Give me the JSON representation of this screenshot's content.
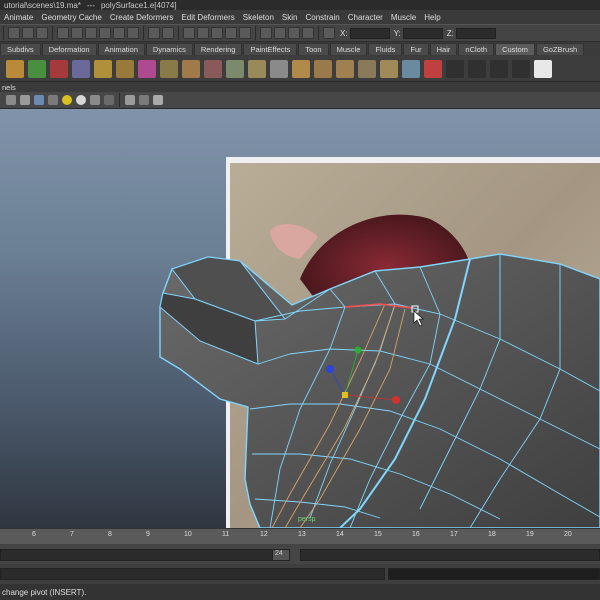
{
  "titlebar": {
    "scene": "utorial\\scenes\\19.ma*",
    "dash": "---",
    "object": "polySurface1.e[4074]"
  },
  "menubar": [
    "Animate",
    "Geometry Cache",
    "Create Deformers",
    "Edit Deformers",
    "Skeleton",
    "Skin",
    "Constrain",
    "Character",
    "Muscle",
    "Help"
  ],
  "statusline": {
    "x_label": "X:",
    "y_label": "Y:",
    "z_label": "Z:"
  },
  "shelf_tabs": [
    "Subdivs",
    "Deformation",
    "Animation",
    "Dynamics",
    "Rendering",
    "PaintEffects",
    "Toon",
    "Muscle",
    "Fluids",
    "Fur",
    "Hair",
    "nCloth",
    "Custom",
    "GoZBrush"
  ],
  "panel_menu": "nels",
  "viewport": {
    "label": "persp"
  },
  "timeslider": {
    "ticks": [
      "6",
      "7",
      "8",
      "9",
      "10",
      "11",
      "12",
      "13",
      "14",
      "15",
      "16",
      "17",
      "18",
      "19",
      "20"
    ]
  },
  "range": {
    "current": "24"
  },
  "helpline": "change pivot (INSERT).",
  "colors": {
    "wire": "#7fd6ff",
    "selected_edge": "#ff4c4c",
    "edge_loop": "#d6a36a",
    "manip_x": "#d33030",
    "manip_y": "#30b030",
    "manip_z": "#2c45d6",
    "manip_center": "#e0c020"
  }
}
